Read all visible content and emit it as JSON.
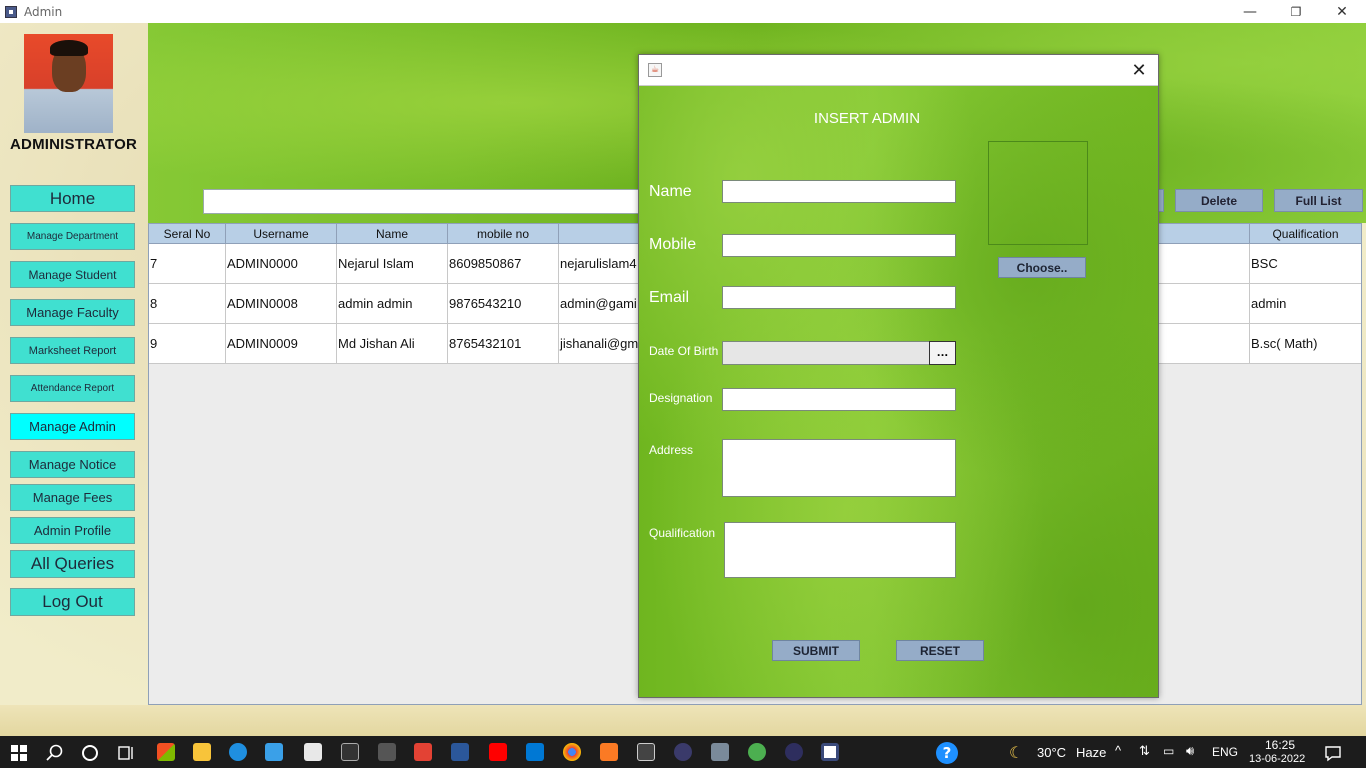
{
  "window": {
    "title": "Admin",
    "minimize": "—",
    "restore": "❐",
    "close": "✕"
  },
  "sidebar": {
    "role_label": "ADMINISTRATOR",
    "items": [
      {
        "label": "Home"
      },
      {
        "label": "Manage Department"
      },
      {
        "label": "Manage Student"
      },
      {
        "label": "Manage Faculty"
      },
      {
        "label": "Marksheet Report"
      },
      {
        "label": "Attendance Report"
      },
      {
        "label": "Manage Admin",
        "active": true
      },
      {
        "label": "Manage Notice"
      },
      {
        "label": "Manage Fees"
      },
      {
        "label": "Admin Profile"
      },
      {
        "label": "All Queries"
      },
      {
        "label": "Log Out"
      }
    ]
  },
  "toolbar": {
    "search_value": "",
    "delete_label": "Delete",
    "full_list_label": "Full List"
  },
  "table": {
    "columns": [
      "Seral No",
      "Username",
      "Name",
      "mobile no",
      "",
      "Qualification"
    ],
    "rows": [
      [
        "7",
        "ADMIN0000",
        "Nejarul Islam",
        "8609850867",
        "nejarulislam4",
        "BSC"
      ],
      [
        "8",
        "ADMIN0008",
        "admin admin",
        "9876543210",
        "admin@gami",
        "admin"
      ],
      [
        "9",
        "ADMIN0009",
        "Md Jishan Ali",
        "8765432101",
        "jishanali@gm",
        "B.sc( Math)"
      ]
    ]
  },
  "dialog": {
    "close": "✕",
    "java_icon": "java-icon",
    "heading": "INSERT ADMIN",
    "labels": {
      "name": "Name",
      "mobile": "Mobile",
      "email": "Email",
      "dob": "Date Of Birth",
      "designation": "Designation",
      "address": "Address",
      "qualification": "Qualification"
    },
    "values": {
      "name": "",
      "mobile": "",
      "email": "",
      "dob": "",
      "designation": "",
      "address": "",
      "qualification": ""
    },
    "dob_button": "...",
    "choose_label": "Choose..",
    "submit_label": "SUBMIT",
    "reset_label": "RESET"
  },
  "taskbar": {
    "weather_temp": "30°C",
    "weather_desc": "Haze",
    "language": "ENG",
    "time": "16:25",
    "date": "13-06-2022"
  },
  "colors": {
    "nav_button": "#40e0d0",
    "nav_active": "#00ffff",
    "action_button": "#95acc8",
    "green_bg": "#77c02a"
  }
}
